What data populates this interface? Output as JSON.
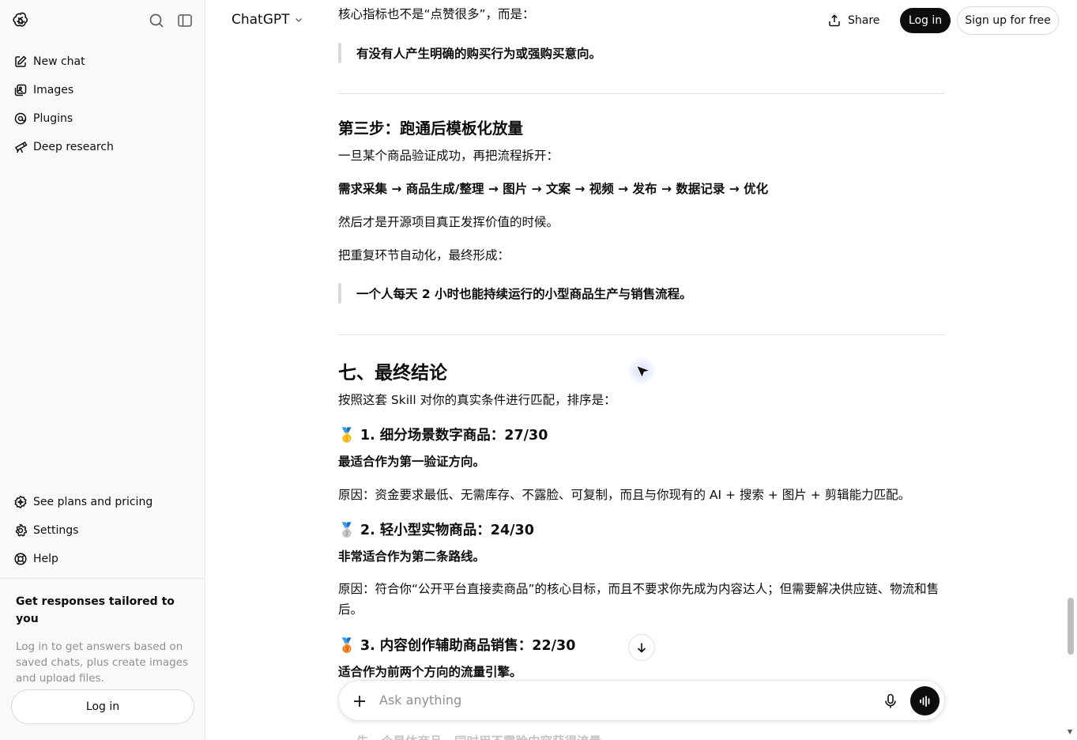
{
  "header": {
    "brand": "ChatGPT",
    "share_label": "Share",
    "login_label": "Log in",
    "signup_label": "Sign up for free"
  },
  "sidebar": {
    "items_top": [
      {
        "label": "New chat",
        "icon": "edit-icon"
      },
      {
        "label": "Images",
        "icon": "images-icon"
      },
      {
        "label": "Plugins",
        "icon": "plugins-icon"
      },
      {
        "label": "Deep research",
        "icon": "telescope-icon"
      }
    ],
    "items_bottom": [
      {
        "label": "See plans and pricing",
        "icon": "sparkle-badge-icon"
      },
      {
        "label": "Settings",
        "icon": "gear-icon"
      },
      {
        "label": "Help",
        "icon": "lifebuoy-icon"
      }
    ],
    "promo_title": "Get responses tailored to you",
    "promo_text": "Log in to get answers based on saved chats, plus create images and upload files.",
    "login_label": "Log in"
  },
  "content": {
    "line1": "核心指标也不是“点赞很多”，而是：",
    "quote1": "有没有人产生明确的购买行为或强购买意向。",
    "step3_heading": "第三步：跑通后模板化放量",
    "step3_intro": "一旦某个商品验证成功，再把流程拆开：",
    "flow": "需求采集 → 商品生成/整理 → 图片 → 文案 → 视频 → 发布 → 数据记录 → 优化",
    "then": "然后才是开源项目真正发挥价值的时候。",
    "automate": "把重复环节自动化，最终形成：",
    "quote2": "一个人每天 2 小时也能持续运行的小型商品生产与销售流程。",
    "section7_heading": "七、最终结论",
    "section7_intro": "按照这套 Skill 对你的真实条件进行匹配，排序是：",
    "rank1_medal": "🥇",
    "rank1_heading": "1. 细分场景数字商品：27/30",
    "rank1_sub": "最适合作为第一验证方向。",
    "rank1_reason": "原因：资金要求最低、无需库存、不露脸、可复制，而且与你现有的 AI + 搜索 + 图片 + 剪辑能力匹配。",
    "rank2_medal": "🥈",
    "rank2_heading": "2. 轻小型实物商品：24/30",
    "rank2_sub": "非常适合作为第二条路线。",
    "rank2_reason": "原因：符合你“公开平台直接卖商品”的核心目标，而且不要求你先成为内容达人；但需要解决供应链、物流和售后。",
    "rank3_medal": "🥉",
    "rank3_heading": "3. 内容创作辅助商品销售：22/30",
    "rank3_sub": "适合作为前两个方向的流量引擎。",
    "cut_line": "先一个是体商品，同时用不露脸内容获得流量"
  },
  "composer": {
    "placeholder": "Ask anything"
  },
  "colors": {
    "accent_dark": "#0d0d0d",
    "sidebar_bg": "#f9f9f9",
    "muted_text": "#8f8f8f"
  }
}
